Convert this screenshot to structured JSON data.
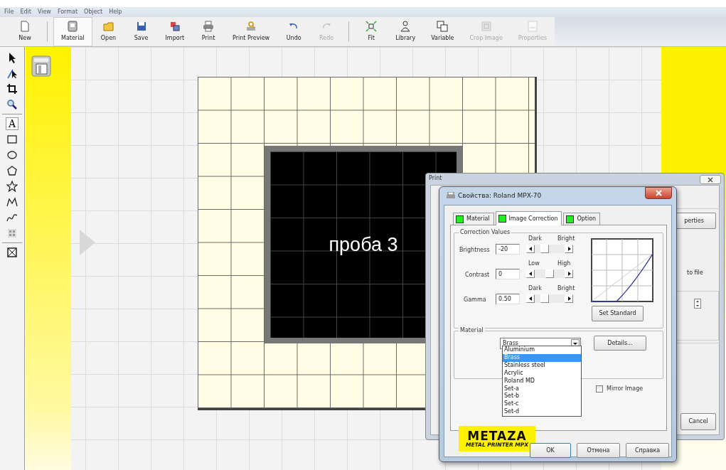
{
  "menu": [
    "File",
    "Edit",
    "View",
    "Format",
    "Object",
    "Help"
  ],
  "toolbar": [
    {
      "label": "New",
      "pressed": false,
      "disabled": false
    },
    {
      "label": "Material",
      "pressed": true,
      "disabled": false
    },
    {
      "label": "Open",
      "pressed": false,
      "disabled": false
    },
    {
      "label": "Save",
      "pressed": false,
      "disabled": false
    },
    {
      "label": "Import",
      "pressed": false,
      "disabled": false
    },
    {
      "label": "Print",
      "pressed": false,
      "disabled": false
    },
    {
      "label": "Print Preview",
      "pressed": false,
      "disabled": false
    },
    {
      "label": "Undo",
      "pressed": false,
      "disabled": false
    },
    {
      "label": "Redo",
      "pressed": false,
      "disabled": true
    },
    {
      "label": "Fit",
      "pressed": false,
      "disabled": false
    },
    {
      "label": "Library",
      "pressed": false,
      "disabled": false
    },
    {
      "label": "Variable",
      "pressed": false,
      "disabled": false
    },
    {
      "label": "Crop Image",
      "pressed": false,
      "disabled": true
    },
    {
      "label": "Properties",
      "pressed": false,
      "disabled": true
    }
  ],
  "tools": [
    {
      "kind": "icon"
    },
    {
      "kind": "icon"
    },
    {
      "kind": "icon"
    },
    {
      "kind": "icon"
    },
    {
      "kind": "glyph",
      "glyph": "A",
      "selected": true
    },
    {
      "kind": "icon"
    },
    {
      "kind": "icon"
    },
    {
      "kind": "icon"
    },
    {
      "kind": "icon"
    },
    {
      "kind": "icon"
    },
    {
      "kind": "icon"
    },
    {
      "kind": "icon"
    },
    {
      "kind": "icon"
    }
  ],
  "canvas": {
    "object_text": "проба 3"
  },
  "print_window": {
    "title": "Print",
    "properties_button": "perties",
    "to_file_label": "to file",
    "cancel_button": "Cancel"
  },
  "dialog": {
    "title": "Свойства: Roland MPX-70",
    "tabs": [
      {
        "label": "Material",
        "selected": false
      },
      {
        "label": "Image Correction",
        "selected": true
      },
      {
        "label": "Option",
        "selected": false
      }
    ],
    "correction_group": "Correction Values",
    "rows": [
      {
        "label": "Brightness",
        "value": "-20",
        "low": "Dark",
        "high": "Bright",
        "level": 0.25
      },
      {
        "label": "Contrast",
        "value": "0",
        "low": "Low",
        "high": "High",
        "level": 0.5
      },
      {
        "label": "Gamma",
        "value": "0.50",
        "low": "Dark",
        "high": "Bright",
        "level": 0.25
      }
    ],
    "set_standard": "Set Standard",
    "material_group": "Material",
    "material_value": "Brass",
    "details_button": "Details...",
    "material_options": [
      {
        "label": "Aluminium",
        "selected": false
      },
      {
        "label": "Brass",
        "selected": true
      },
      {
        "label": "Stainless steel",
        "selected": false
      },
      {
        "label": "Acrylic",
        "selected": false
      },
      {
        "label": "Roland MD",
        "selected": false
      },
      {
        "label": "Set-a",
        "selected": false
      },
      {
        "label": "Set-b",
        "selected": false
      },
      {
        "label": "Set-c",
        "selected": false
      },
      {
        "label": "Set-d",
        "selected": false
      }
    ],
    "mirror_image": {
      "label": "Mirror Image",
      "checked": false
    },
    "logo": {
      "name": "METAZA",
      "tagline": "METAL PRINTER MPX"
    },
    "buttons": [
      "OK",
      "Отмена",
      "Справка"
    ]
  }
}
